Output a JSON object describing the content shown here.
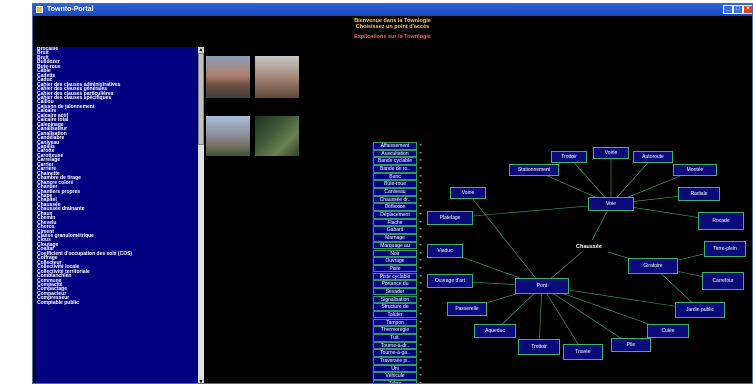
{
  "window": {
    "title": "Townto-Portal",
    "buttons": [
      "_",
      "□",
      "×"
    ]
  },
  "header": {
    "welcome": "Bienvenue dans la Townlogie",
    "choose": "Choisissez un point d'accès",
    "explanations": "Explications sur la Townlogie"
  },
  "left_list": [
    "Brocaille",
    "Bruit",
    "Bruit",
    "Bulldozer",
    "Bute-roue",
    "Câble",
    "Cadette",
    "Caduc",
    "Cahier des clauses administratives",
    "Cahier des clauses générales",
    "Cahier des clauses particulières",
    "Cahier des clauses spécifiques",
    "Caillou",
    "Caisson de jalonnement",
    "Calcaire",
    "Calcaire actif",
    "Calcaire total",
    "Calepinage",
    "Canalisateur",
    "Canalisation",
    "Candélabre",
    "Caniveau",
    "Capillis",
    "Carotte",
    "Carotteuse",
    "Carrelage",
    "Carrier",
    "Carrière",
    "Chainette",
    "Chambre de tirage",
    "Chancre coloré",
    "Chantier",
    "Chantiers propres",
    "Chape",
    "Chapitel",
    "Chaussée",
    "Chaussée drainante",
    "Chaux",
    "Chemin",
    "Chevelu",
    "Choros",
    "Ciment",
    "Classe granulométrique",
    "Clous",
    "Cloutage",
    "Coaltar",
    "Coefficient d'occupation des sols (COS)",
    "Coffrage",
    "Collecteur",
    "Collectivité locale",
    "Collectivité territoriale",
    "Comblanchien",
    "Commune",
    "Compacité",
    "Compactage",
    "Compacteur",
    "Compresseur",
    "Comptable public"
  ],
  "mid_list": [
    "Affaissement",
    "Auscultation",
    "Bande cyclable",
    "Bande de ro..",
    "Banc",
    "Bute-roue",
    "Caniveau",
    "Chaussée dr..",
    "Déflexion",
    "Déplacement",
    "Flache",
    "Gabarit",
    "Marnage",
    "Marquage au",
    "Noir",
    "Ouvrage",
    "Piste",
    "Piste cyclable",
    "Portance du",
    "Sevader",
    "Signalisation",
    "Structure de",
    "Taluter",
    "Tampon",
    "Thermorégle",
    "Tuit.",
    "Tourne-à-dr..",
    "Tourne-à-ga..",
    "Traversée pi..",
    "Uni",
    "Véhicule",
    "Zébra"
  ],
  "graph": {
    "center": "Chaussée",
    "nodes": {
      "voirie": "Voirie",
      "trottoir_top": "Trottoir",
      "voirie_top": "Voirie",
      "autoroute": "Autoroute",
      "stationnement": "Stationnement",
      "montee": "Montée",
      "voie": "Voie",
      "radiale": "Radiale",
      "rocade": "Rocade",
      "platelage": "Platelage",
      "viaduc": "Viaduc",
      "ouvrage_art": "Ouvrage d'art",
      "pont": "Pont",
      "giratoire": "Giratoire",
      "terre_plein": "Terre-plein",
      "carrefour": "Carrefour",
      "passerelle": "Passerelle",
      "jardin_public": "Jardin public",
      "aqueduc": "Aqueduc",
      "culee": "Culée",
      "trottoir_bot": "Trottoir",
      "travee": "Travée",
      "pile": "Pile"
    }
  }
}
